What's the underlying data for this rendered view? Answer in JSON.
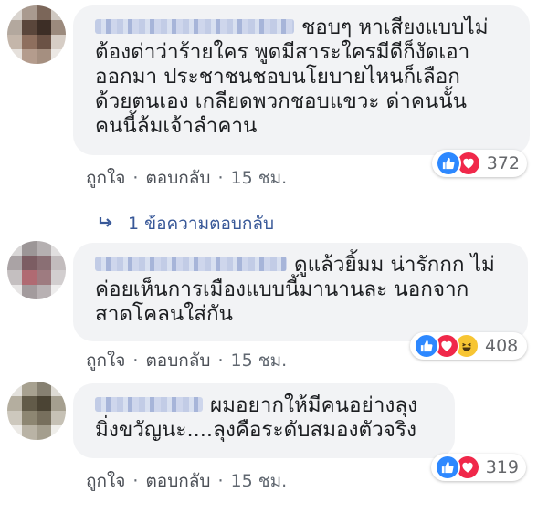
{
  "comments": [
    {
      "text": "ชอบๆ หาเสียงแบบไม่\nต้องด่าว่าร้ายใคร พูดมีสาระใครมีดีก็งัดเอา\nออกมา ประชาชนชอบนโยบายไหนก็เลือก\nด้วยตนเอง เกลียดพวกชอบแขวะ ด่าคนนั้น\nคนนี้ล้มเจ้าลำคาน",
      "reaction_count": "372",
      "reactions": [
        "like-icon",
        "love-icon"
      ],
      "like_label": "ถูกใจ",
      "reply_label": "ตอบกลับ",
      "time": "15 ชม."
    },
    {
      "text": "ดูแล้วยิ้มม น่ารักกก ไม่\nค่อยเห็นการเมืองแบบนี้มานานละ นอกจาก\nสาดโคลนใส่กัน",
      "reaction_count": "408",
      "reactions": [
        "like-icon",
        "love-icon",
        "haha-icon"
      ],
      "like_label": "ถูกใจ",
      "reply_label": "ตอบกลับ",
      "time": "15 ชม."
    },
    {
      "text": "ผมอยากให้มีคนอย่างลุง\nมิ่งขวัญนะ....ลุงคือระดับสมองตัวจริง",
      "reaction_count": "319",
      "reactions": [
        "like-icon",
        "love-icon"
      ],
      "like_label": "ถูกใจ",
      "reply_label": "ตอบกลับ",
      "time": "15 ชม."
    }
  ],
  "replies_link": "1 ข้อความตอบกลับ",
  "colors": {
    "bubble": "#f2f3f5",
    "like": "#2d88ff",
    "love": "#f0284a",
    "haha": "#f7c533",
    "link": "#385898"
  }
}
